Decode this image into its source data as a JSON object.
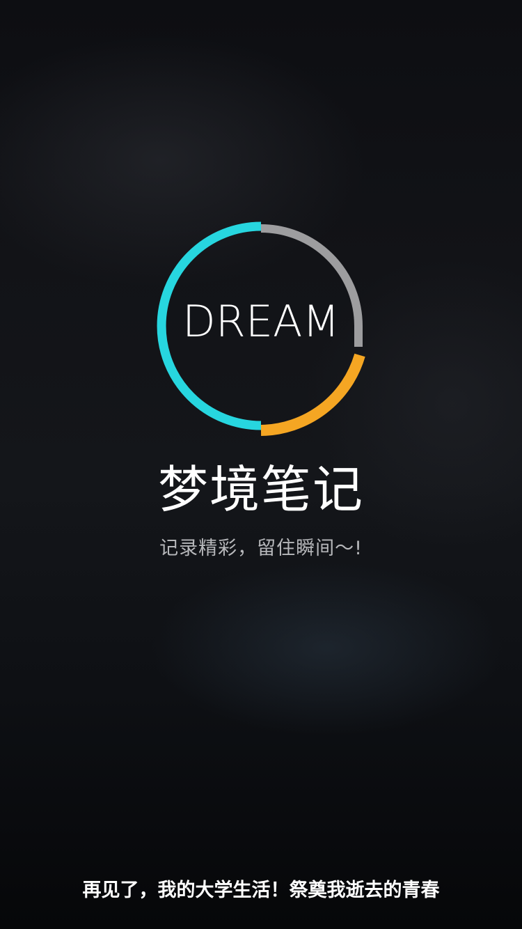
{
  "logo": {
    "text": "DREAM",
    "ring_colors": {
      "teal": "#27d6df",
      "gray": "#9d9d9f",
      "orange": "#f5a623"
    }
  },
  "app": {
    "title": "梦境笔记",
    "tagline": "记录精彩，留住瞬间～!"
  },
  "footer": {
    "text": "再见了，我的大学生活！祭奠我逝去的青春"
  },
  "colors": {
    "background": "#111215",
    "title": "#ffffff",
    "tagline": "#b7b8bb"
  }
}
